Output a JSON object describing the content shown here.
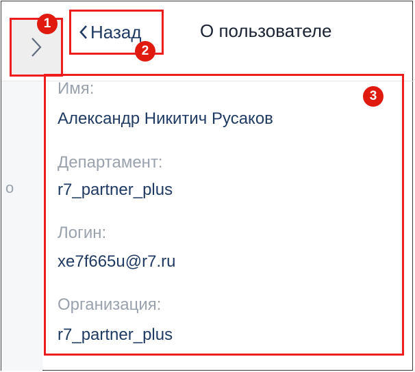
{
  "header": {
    "back_label": "Назад",
    "title": "О пользователе"
  },
  "sidebar": {
    "partial_glyph": "о"
  },
  "user": {
    "name_label": "Имя:",
    "name": "Александр Никитич Русаков",
    "department_label": "Департамент:",
    "department": "r7_partner_plus",
    "login_label": "Логин:",
    "login": "xe7f665u@r7.ru",
    "organization_label": "Организация:",
    "organization": "r7_partner_plus"
  },
  "annotations": {
    "badge_1": "1",
    "badge_2": "2",
    "badge_3": "3",
    "color": "#e01a0f"
  },
  "icons": {
    "toggle": "chevron-right-icon",
    "back": "chevron-left-icon"
  }
}
